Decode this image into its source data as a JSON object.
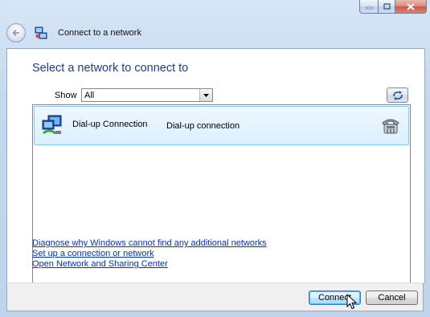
{
  "window": {
    "title": "Connect to a network",
    "caption_buttons": [
      "minimize",
      "maximize",
      "close"
    ]
  },
  "nav": {
    "back_icon": "back-arrow-icon",
    "wizard_icon": "network-wizard-icon"
  },
  "main": {
    "heading": "Select a network to connect to",
    "show_label": "Show",
    "show_value": "All",
    "refresh_icon": "refresh-icon",
    "networks": [
      {
        "name": "Dial-up Connection",
        "type": "Dial-up connection",
        "icon": "dialup-network-icon",
        "status_icon": "telephone-icon",
        "selected": true
      }
    ]
  },
  "links": [
    "Diagnose why Windows cannot find any additional networks",
    "Set up a connection or network",
    "Open Network and Sharing Center"
  ],
  "footer": {
    "connect_label": "Connect",
    "cancel_label": "Cancel"
  },
  "colors": {
    "heading": "#1d3e8e",
    "link": "#0033cc",
    "selection_border": "#8cc6ea",
    "selection_bg": "#dcefff"
  }
}
